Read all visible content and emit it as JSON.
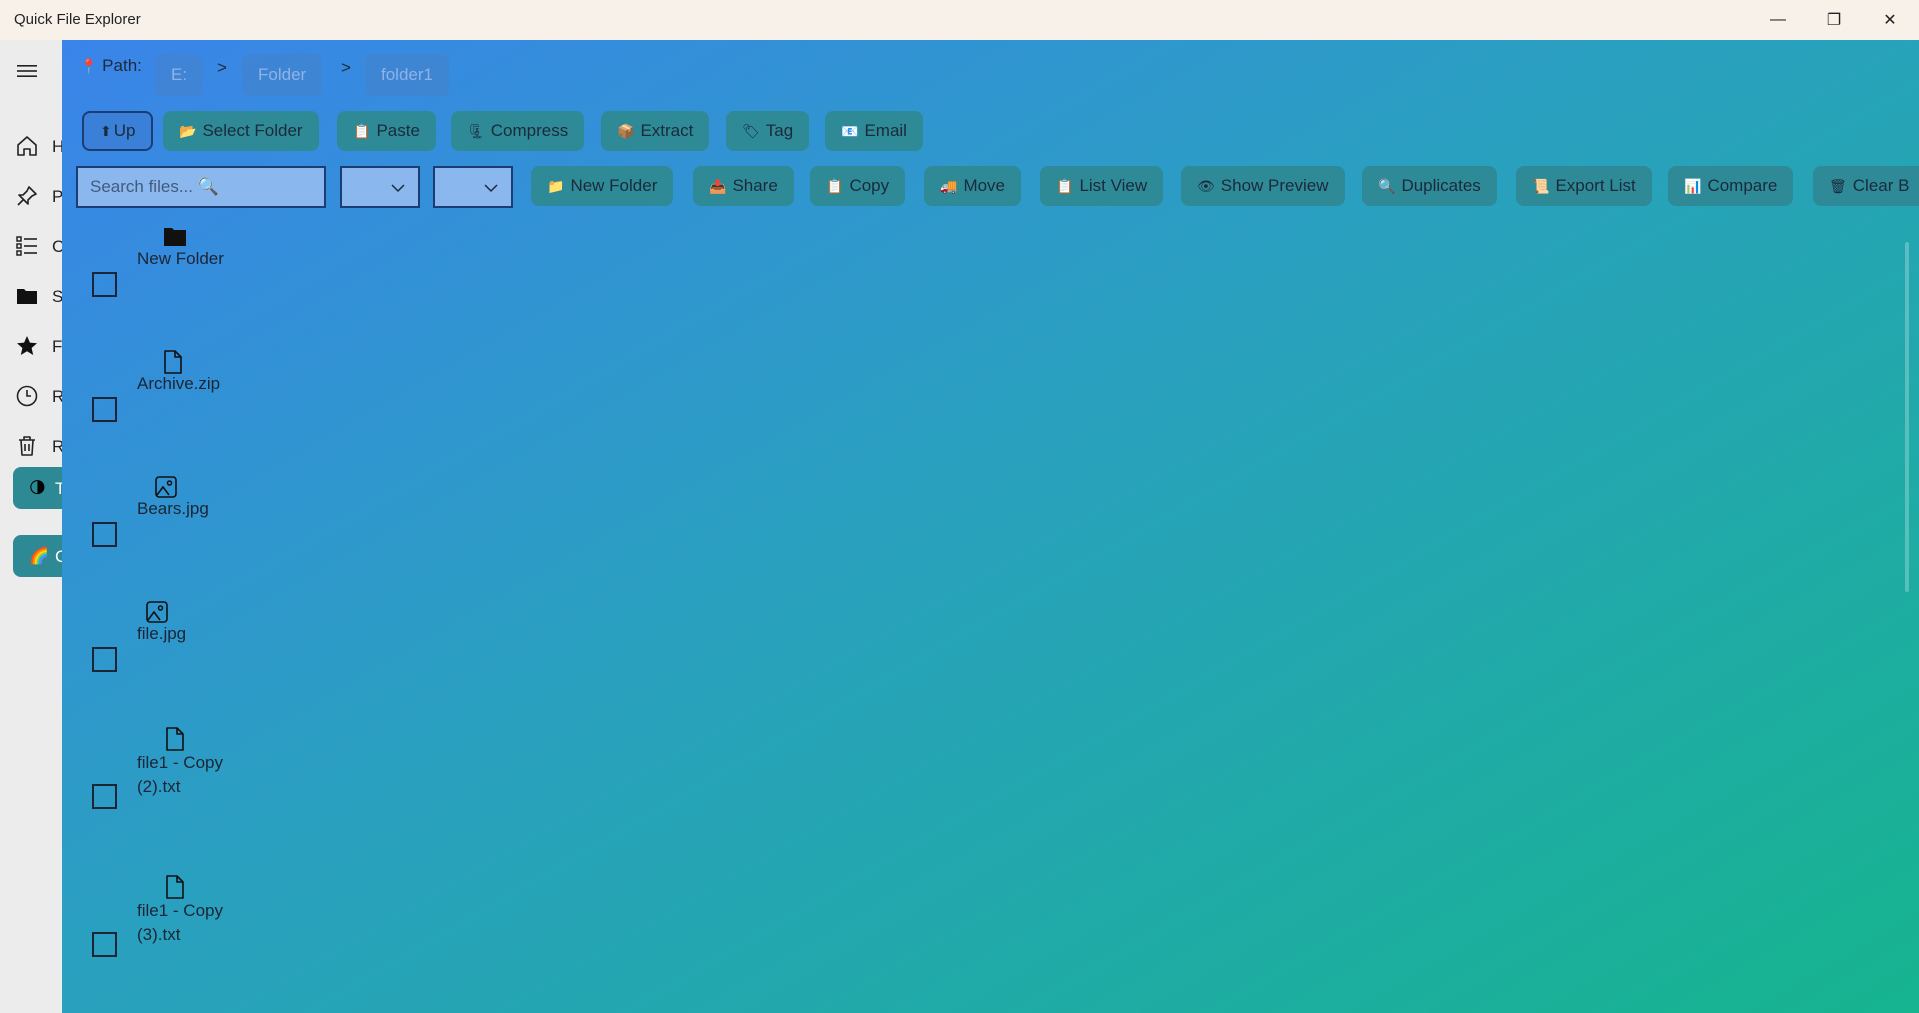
{
  "app": {
    "title": "Quick File Explorer"
  },
  "window_controls": {
    "minimize": "—",
    "maximize": "❐",
    "close": "✕"
  },
  "nav": {
    "items": [
      {
        "icon": "home-icon",
        "label": "H"
      },
      {
        "icon": "pin-icon",
        "label": "P"
      },
      {
        "icon": "list-icon",
        "label": "C"
      },
      {
        "icon": "folder-icon",
        "label": "S"
      },
      {
        "icon": "star-icon",
        "label": "F"
      },
      {
        "icon": "clock-icon",
        "label": "R"
      },
      {
        "icon": "trash-icon",
        "label": "R"
      }
    ],
    "pills": [
      {
        "emoji": "🌗",
        "label": "T"
      },
      {
        "emoji": "🌈",
        "label": "C"
      }
    ]
  },
  "path": {
    "label": "Path:",
    "pin_emoji": "📍",
    "crumbs": [
      "E:",
      "Folder",
      "folder1"
    ],
    "separator": ">"
  },
  "toolbar1": [
    {
      "emoji": "⬆",
      "label": "Up"
    },
    {
      "emoji": "📂",
      "label": "Select Folder"
    },
    {
      "emoji": "📋",
      "label": "Paste"
    },
    {
      "emoji": "🗜",
      "label": "Compress"
    },
    {
      "emoji": "📦",
      "label": "Extract"
    },
    {
      "emoji": "🏷",
      "label": "Tag"
    },
    {
      "emoji": "📧",
      "label": "Email"
    }
  ],
  "search": {
    "placeholder": "Search files... 🔍"
  },
  "toolbar2": [
    {
      "emoji": "📁",
      "label": "New Folder"
    },
    {
      "emoji": "📤",
      "label": "Share"
    },
    {
      "emoji": "📋",
      "label": "Copy"
    },
    {
      "emoji": "🚚",
      "label": "Move"
    },
    {
      "emoji": "📋",
      "label": "List View"
    },
    {
      "emoji": "👁",
      "label": "Show Preview"
    },
    {
      "emoji": "🔍",
      "label": "Duplicates"
    },
    {
      "emoji": "📜",
      "label": "Export List"
    },
    {
      "emoji": "📊",
      "label": "Compare"
    },
    {
      "emoji": "🗑",
      "label": "Clear B"
    }
  ],
  "files": [
    {
      "icon": "folder-icon",
      "name_lines": [
        "New Folder"
      ]
    },
    {
      "icon": "document-icon",
      "name_lines": [
        "Archive.zip"
      ]
    },
    {
      "icon": "image-icon",
      "name_lines": [
        "Bears.jpg"
      ]
    },
    {
      "icon": "image-icon",
      "name_lines": [
        "file.jpg"
      ]
    },
    {
      "icon": "document-icon",
      "name_lines": [
        "file1 - Copy",
        "(2).txt"
      ]
    },
    {
      "icon": "document-icon",
      "name_lines": [
        "file1 - Copy",
        "(3).txt"
      ]
    }
  ]
}
